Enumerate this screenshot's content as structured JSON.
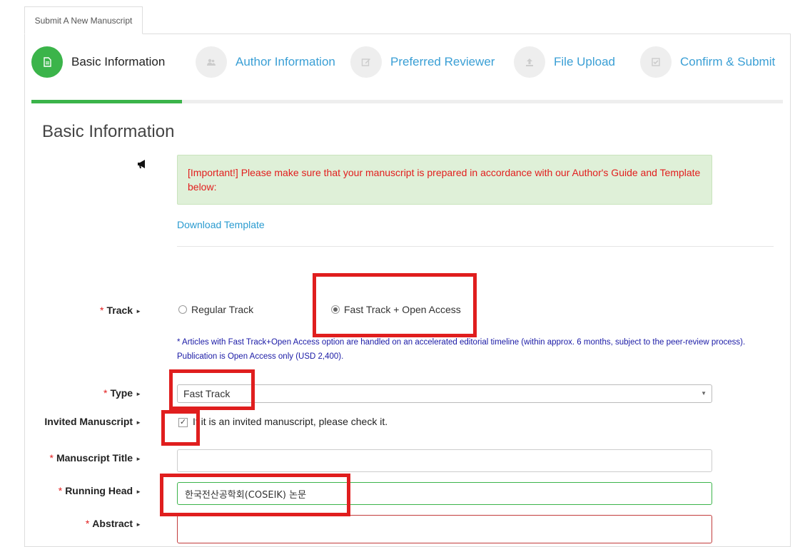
{
  "tab": {
    "label": "Submit A New Manuscript"
  },
  "steps": [
    {
      "label": "Basic Information",
      "icon": "document-icon",
      "active": true
    },
    {
      "label": "Author Information",
      "icon": "users-icon",
      "active": false
    },
    {
      "label": "Preferred Reviewer",
      "icon": "edit-icon",
      "active": false
    },
    {
      "label": "File Upload",
      "icon": "upload-icon",
      "active": false
    },
    {
      "label": "Confirm & Submit",
      "icon": "checkbox-icon",
      "active": false
    }
  ],
  "progress": {
    "fraction": 0.2
  },
  "section": {
    "title": "Basic Information"
  },
  "notice": {
    "text": "[Important!] Please make sure that your manuscript is prepared in accordance with our Author's Guide and Template below:"
  },
  "download": {
    "label": "Download Template"
  },
  "form": {
    "track": {
      "label": "Track",
      "options": [
        "Regular Track",
        "Fast Track + Open Access"
      ],
      "selected": "Fast Track + Open Access",
      "note": "* Articles with Fast Track+Open Access option are handled on an accelerated editorial timeline (within approx. 6 months, subject to the peer-review process). Publication is Open Access only (USD 2,400)."
    },
    "type": {
      "label": "Type",
      "value": "Fast Track"
    },
    "invited": {
      "label": "Invited Manuscript",
      "checked": true,
      "text": "If it is an invited manuscript, please check it."
    },
    "title": {
      "label": "Manuscript Title",
      "value": ""
    },
    "running_head": {
      "label": "Running Head",
      "value": "한국전산공학회(COSEIK) 논문"
    },
    "abstract": {
      "label": "Abstract",
      "value": ""
    }
  },
  "colors": {
    "accent": "#3bb44a",
    "link": "#2a9bd0",
    "required": "#e21d1d",
    "annotation": "#e01e1e"
  }
}
